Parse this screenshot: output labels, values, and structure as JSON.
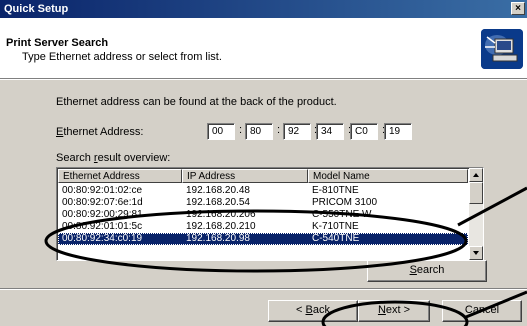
{
  "window": {
    "title": "Quick Setup",
    "close_label": "×"
  },
  "header": {
    "title": "Print Server Search",
    "subtitle": "Type Ethernet address or select from list."
  },
  "body": {
    "info_text": "Ethernet address can be found at the back of the product.",
    "ethernet_label_prefix": "E",
    "ethernet_label_rest": "thernet Address:",
    "mac": [
      "00",
      "80",
      "92",
      "34",
      "C0",
      "19"
    ],
    "separator": ":",
    "search_label_a": "Search ",
    "search_label_u": "r",
    "search_label_b": "esult overview:"
  },
  "list": {
    "columns": [
      "Ethernet Address",
      "IP Address",
      "Model Name"
    ],
    "rows": [
      {
        "mac": "00:80:92:01:02:ce",
        "ip": "192.168.20.48",
        "model": "E-810TNE",
        "selected": false
      },
      {
        "mac": "00:80:92:07:6e:1d",
        "ip": "192.168.20.54",
        "model": "PRICOM 3100",
        "selected": false
      },
      {
        "mac": "00:80:92:00:29:81",
        "ip": "192.168.20.206",
        "model": "C-550TNE W",
        "selected": false
      },
      {
        "mac": "00:80:92:01:01:5c",
        "ip": "192.168.20.210",
        "model": "K-710TNE",
        "selected": false
      },
      {
        "mac": "00:80:92:34:c0:19",
        "ip": "192.168.20.98",
        "model": "C-540TNE",
        "selected": true
      }
    ]
  },
  "buttons": {
    "search_u": "S",
    "search_rest": "earch",
    "back_a": "< ",
    "back_u": "B",
    "back_b": "ack",
    "next_u": "N",
    "next_b": "ext >",
    "cancel": "Cancel"
  },
  "colors": {
    "selection": "#0a246a",
    "titlebar": "#0a246a",
    "dialog_bg": "#d4d0c8"
  }
}
